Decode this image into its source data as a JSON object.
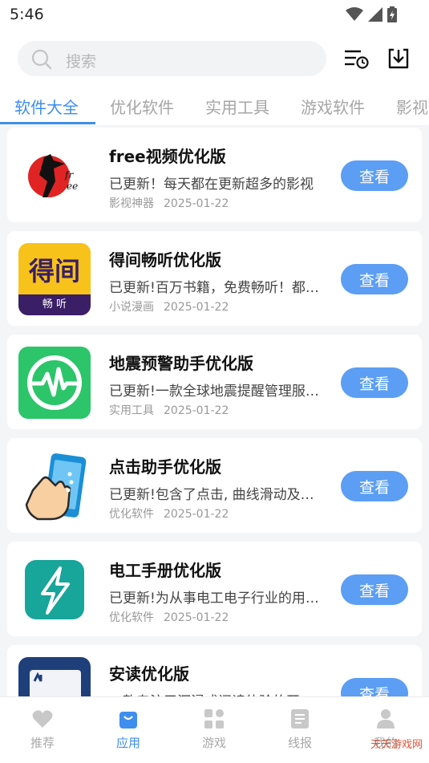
{
  "status": {
    "time": "5:46"
  },
  "search": {
    "placeholder": "搜索"
  },
  "tabs": [
    "软件大全",
    "优化软件",
    "实用工具",
    "游戏软件",
    "影视"
  ],
  "apps": [
    {
      "title": "free视频优化版",
      "desc": "已更新！每天都在更新超多的影视",
      "category": "影视神器",
      "date": "2025-01-22",
      "button": "查看"
    },
    {
      "title": "得间畅听优化版",
      "desc": "已更新!百万书籍，免费畅听！都在这里",
      "category": "小说漫画",
      "date": "2025-01-22",
      "button": "查看"
    },
    {
      "title": "地震预警助手优化版",
      "desc": "已更新!一款全球地震提醒管理服务软件",
      "category": "实用工具",
      "date": "2025-01-22",
      "button": "查看"
    },
    {
      "title": "点击助手优化版",
      "desc": "已更新!包含了点击, 曲线滑动及更多",
      "category": "优化软件",
      "date": "2025-01-22",
      "button": "查看"
    },
    {
      "title": "电工手册优化版",
      "desc": "已更新!为从事电工电子行业的用户提供",
      "category": "优化软件",
      "date": "2025-01-22",
      "button": "查看"
    },
    {
      "title": "安读优化版",
      "desc": "一款专注于沉浸式阅读体验的开",
      "category": "",
      "date": "",
      "button": "查看"
    }
  ],
  "icon_text": {
    "dejian_main": "得间",
    "dejian_sub": "畅 听"
  },
  "nav": [
    {
      "label": "推荐",
      "icon": "heart-icon"
    },
    {
      "label": "应用",
      "icon": "app-bag-icon"
    },
    {
      "label": "游戏",
      "icon": "grid-icon"
    },
    {
      "label": "线报",
      "icon": "news-icon"
    },
    {
      "label": "我的",
      "icon": "user-icon"
    }
  ],
  "watermark": "天天游戏网",
  "colors": {
    "accent": "#3e8ef0",
    "button": "#5b9ef4"
  }
}
